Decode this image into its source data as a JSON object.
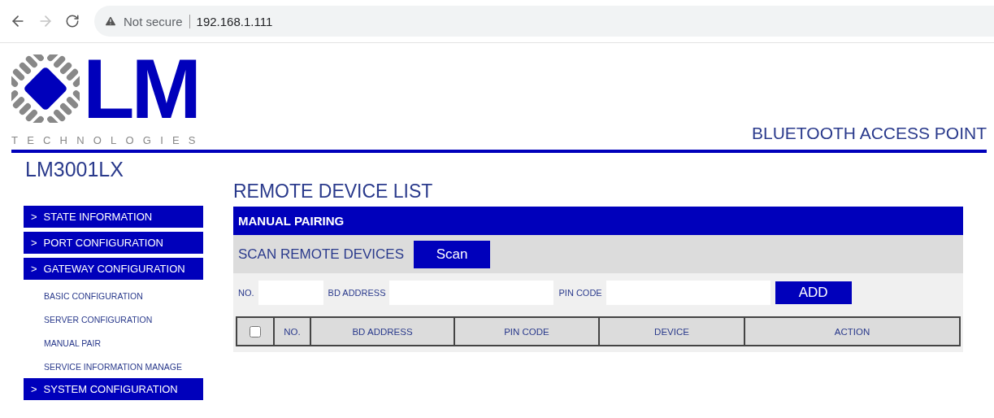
{
  "browser": {
    "back_enabled": true,
    "forward_enabled": false,
    "security": "Not secure",
    "url": "192.168.1.111"
  },
  "logo": {
    "mark": "LM",
    "tagline": "TECHNOLOGIES"
  },
  "header": {
    "product": "BLUETOOTH ACCESS POINT"
  },
  "sidebar": {
    "model": "LM3001LX",
    "items": [
      {
        "marker": ">",
        "label": "STATE INFORMATION"
      },
      {
        "marker": ">",
        "label": "PORT CONFIGURATION"
      },
      {
        "marker": ">",
        "label": "GATEWAY CONFIGURATION",
        "children": [
          {
            "label": "BASIC CONFIGURATION"
          },
          {
            "label": "SERVER CONFIGURATION"
          },
          {
            "label": "MANUAL PAIR"
          },
          {
            "label": "SERVICE INFORMATION MANAGE"
          }
        ]
      },
      {
        "marker": ">",
        "label": "SYSTEM CONFIGURATION"
      }
    ]
  },
  "main": {
    "title": "REMOTE DEVICE LIST",
    "panel": {
      "heading": "MANUAL PAIRING",
      "scan_label": "SCAN REMOTE DEVICES",
      "scan_button": "Scan",
      "fields": [
        {
          "label": "NO.",
          "kind": "short"
        },
        {
          "label": "BD ADDRESS",
          "kind": "long"
        },
        {
          "label": "PIN CODE",
          "kind": "long"
        }
      ],
      "add_button": "ADD",
      "table": {
        "select_all_checked": false,
        "columns": [
          "NO.",
          "BD ADDRESS",
          "PIN CODE",
          "DEVICE",
          "ACTION"
        ]
      }
    }
  }
}
